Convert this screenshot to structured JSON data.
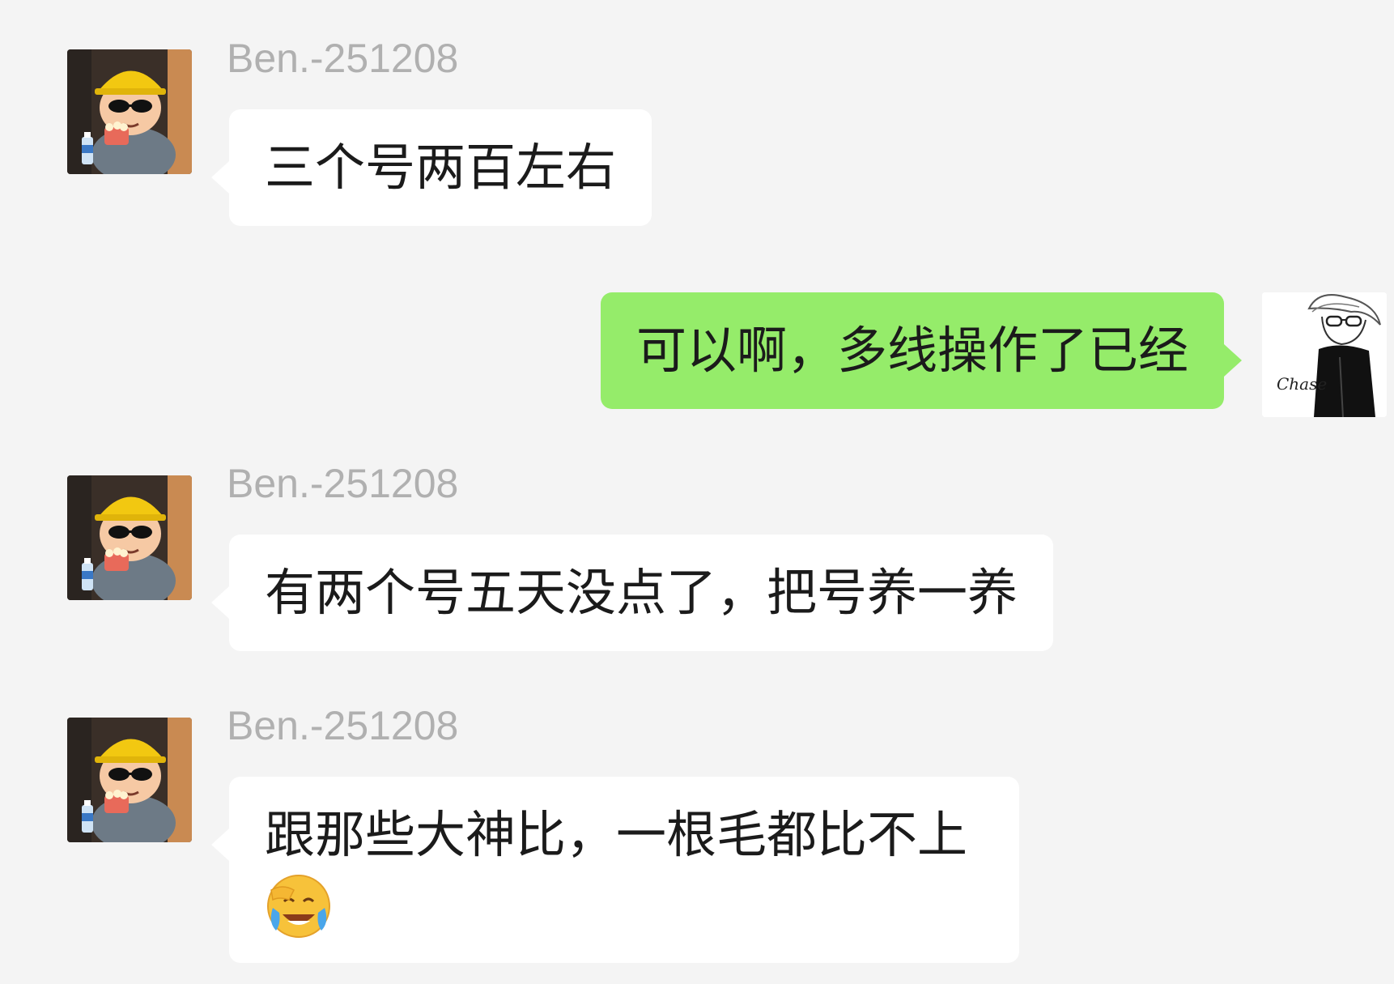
{
  "chat": {
    "messages": [
      {
        "sender": "Ben.-251208",
        "direction": "in",
        "text": "三个号两百左右",
        "avatar_icon": "crayon-shin-chan-hardhat-avatar"
      },
      {
        "sender": "",
        "direction": "out",
        "text": "可以啊，多线操作了已经",
        "avatar_icon": "sketch-man-glasses-avatar",
        "avatar_caption": "Chase"
      },
      {
        "sender": "Ben.-251208",
        "direction": "in",
        "text": "有两个号五天没点了，把号养一养",
        "avatar_icon": "crayon-shin-chan-hardhat-avatar"
      },
      {
        "sender": "Ben.-251208",
        "direction": "in",
        "text": "跟那些大神比，一根毛都比不上",
        "avatar_icon": "crayon-shin-chan-hardhat-avatar",
        "emoji": "face-palm-tears-emoji"
      }
    ]
  },
  "colors": {
    "background": "#f4f4f4",
    "incoming_bubble": "#ffffff",
    "outgoing_bubble": "#95ec6a",
    "sender_name": "#b0b0b0"
  }
}
